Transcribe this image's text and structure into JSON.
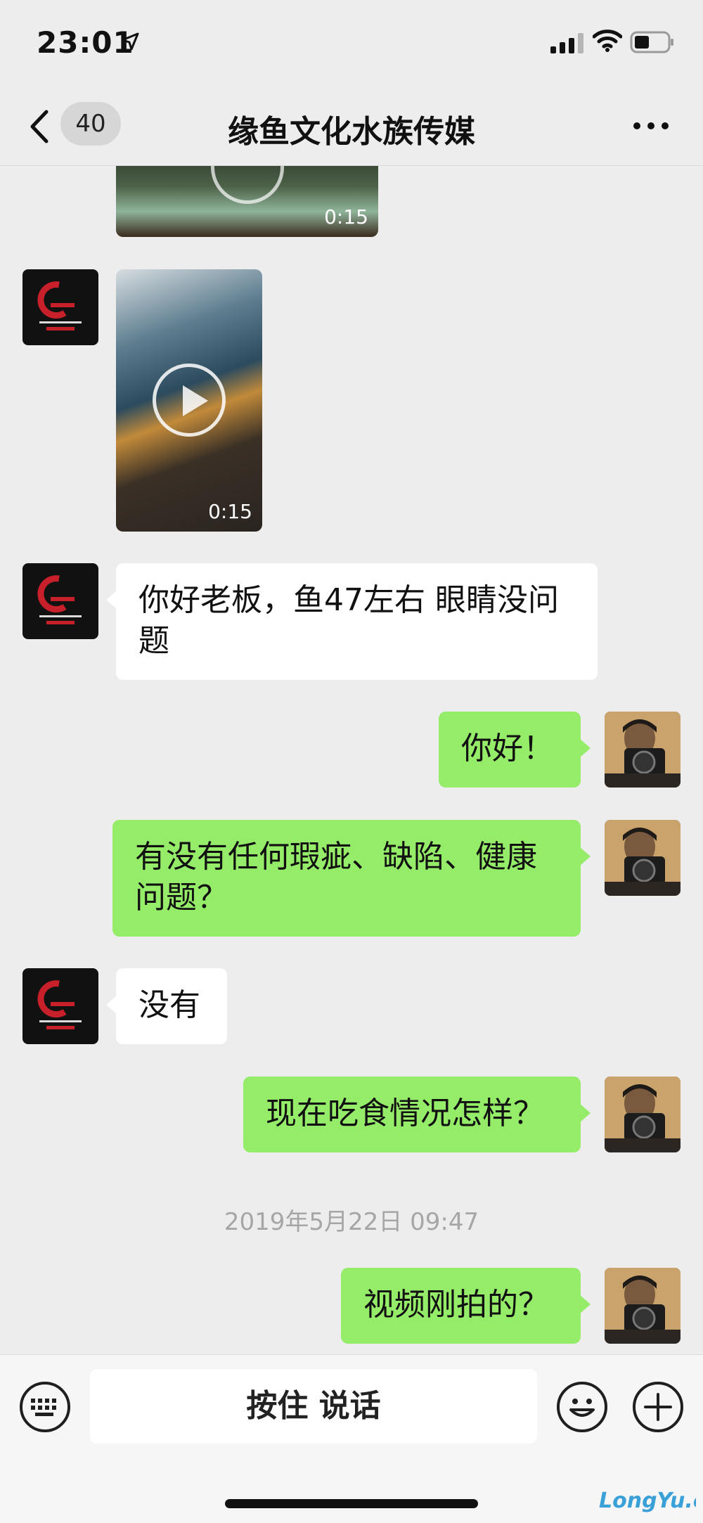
{
  "status_bar": {
    "time": "23:01"
  },
  "nav": {
    "unread_count": "40",
    "title": "缘鱼文化水族传媒"
  },
  "messages": [
    {
      "type": "video",
      "side": "in",
      "duration": "0:15"
    },
    {
      "type": "video",
      "side": "in",
      "duration": "0:15"
    },
    {
      "type": "text",
      "side": "in",
      "text": "你好老板，鱼47左右 眼睛没问题"
    },
    {
      "type": "text",
      "side": "out",
      "text": "你好！"
    },
    {
      "type": "text",
      "side": "out",
      "text": "有没有任何瑕疵、缺陷、健康问题？"
    },
    {
      "type": "text",
      "side": "in",
      "text": "没有"
    },
    {
      "type": "text",
      "side": "out",
      "text": "现在吃食情况怎样？"
    },
    {
      "type": "timestamp",
      "text": "2019年5月22日 09:47"
    },
    {
      "type": "text",
      "side": "out",
      "text": "视频刚拍的？"
    }
  ],
  "input_bar": {
    "hold_to_talk_label": "按住 说话"
  },
  "watermark": {
    "text": "LongYu.cc"
  },
  "colors": {
    "outgoing_bubble": "#95ec69",
    "incoming_bubble": "#ffffff",
    "background": "#ededed"
  }
}
